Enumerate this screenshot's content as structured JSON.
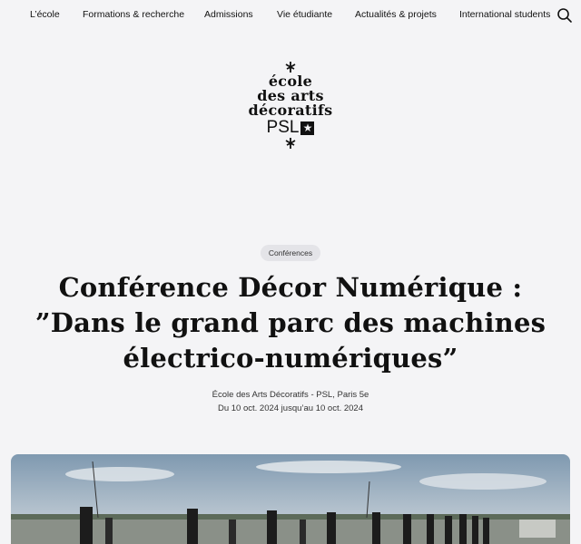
{
  "nav": {
    "items": [
      {
        "label": "L’école"
      },
      {
        "label": "Formations & recherche"
      },
      {
        "label": "Admissions"
      },
      {
        "label": "Vie étudiante"
      },
      {
        "label": "Actualités & projets"
      },
      {
        "label": "International students"
      }
    ],
    "search_icon": "search-icon"
  },
  "logo": {
    "line1": "école",
    "line2": "des arts",
    "line3": "décoratifs",
    "psl": "PSL",
    "star": "★",
    "ornament": "ornament-icon"
  },
  "event": {
    "tag": "Conférences",
    "title": "Conférence Décor Numérique : ”Dans le grand parc des machines électrico-numériques”",
    "location": "École des Arts Décoratifs - PSL, Paris 5e",
    "dates": "Du 10 oct. 2024 jusqu’au 10 oct. 2024"
  },
  "colors": {
    "background": "#f4f4f6",
    "text": "#111111",
    "tag_bg": "#e4e4e8"
  }
}
